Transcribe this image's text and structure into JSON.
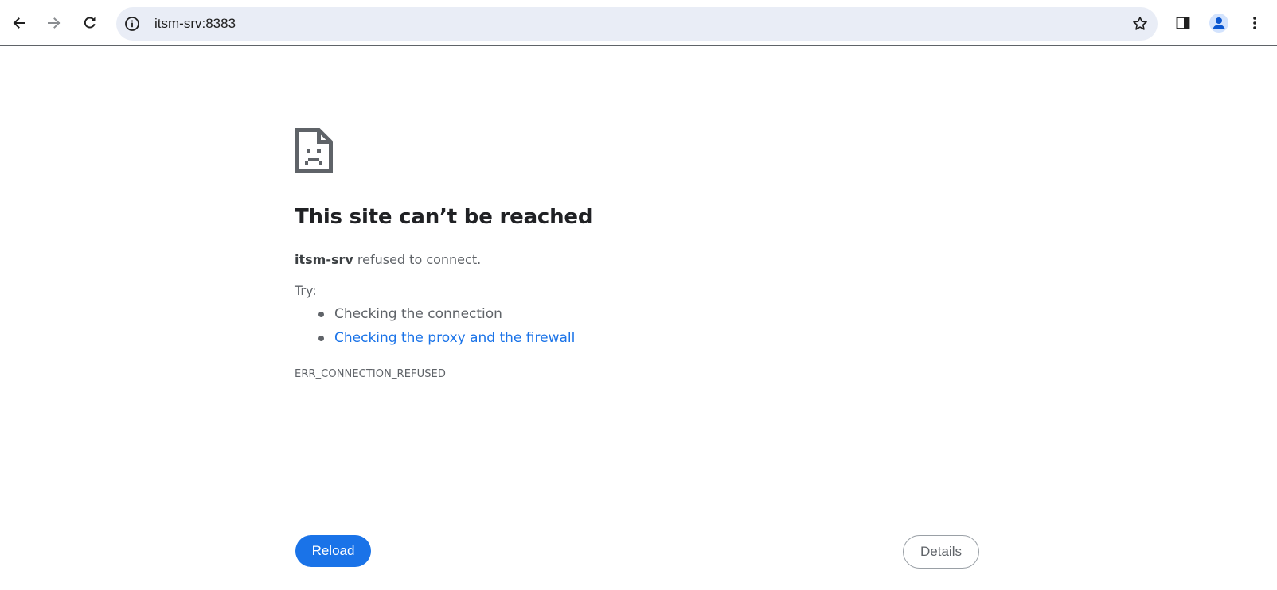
{
  "browser": {
    "url": "itsm-srv:8383",
    "icons": {
      "back": "arrow-left-icon",
      "forward": "arrow-right-icon",
      "reload": "reload-icon",
      "site_info": "info-icon",
      "bookmark": "star-icon",
      "side_panel": "side-panel-icon",
      "profile": "profile-icon",
      "menu": "more-vert-icon"
    }
  },
  "error_page": {
    "icon": "sad-document-icon",
    "title": "This site can’t be reached",
    "host": "itsm-srv",
    "message": " refused to connect.",
    "try_label": "Try:",
    "suggestions": [
      {
        "text": "Checking the connection",
        "is_link": false
      },
      {
        "text": "Checking the proxy and the firewall",
        "is_link": true
      }
    ],
    "error_code": "ERR_CONNECTION_REFUSED",
    "reload_label": "Reload",
    "details_label": "Details"
  },
  "colors": {
    "accent": "#1a73e8",
    "omnibox_bg": "#e9edf6",
    "text_primary": "#202124",
    "text_secondary": "#5f6368"
  }
}
